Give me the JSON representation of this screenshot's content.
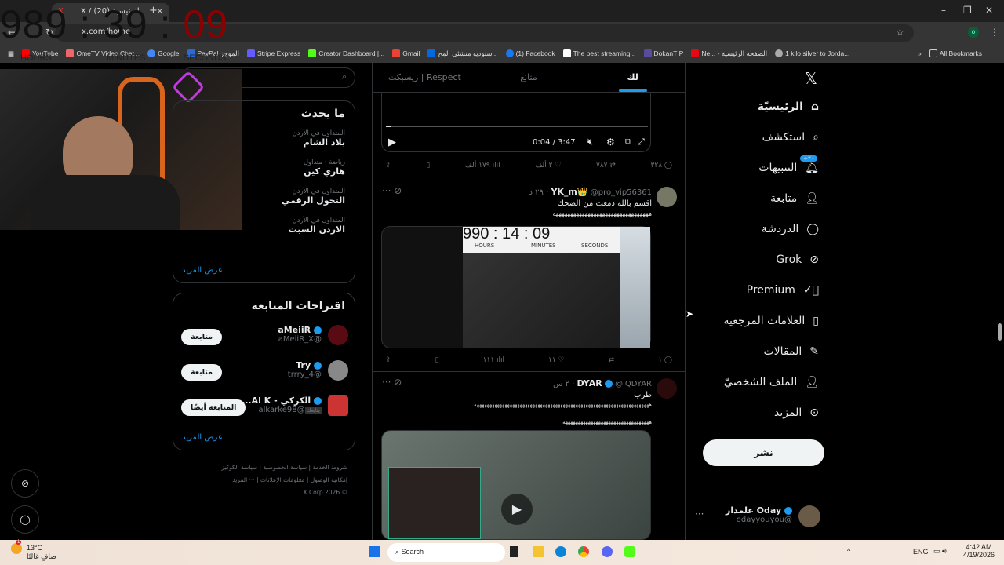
{
  "browser": {
    "tab_title": "X / الرئيسية (20)",
    "url": "x.com/home",
    "bookmarks": [
      "YouTube",
      "OmeTV Video Chat...",
      "Google",
      "PayPal الموجز",
      "Stripe Express",
      "Creator Dashboard |...",
      "Gmail",
      "ستوديو منشئي المح...",
      "(1) Facebook",
      "The best streaming...",
      "DokanTIP",
      "Ne... - الصفحة الرئيسية",
      "1 kilo silver to Jorda..."
    ],
    "all_bookmarks": "All Bookmarks",
    "profile_initial": "o"
  },
  "overlay": {
    "hours": "989",
    "minutes": "39",
    "seconds": "09",
    "hours_label": "HOURS",
    "minutes_label": "MINUTES",
    "seconds_label": "SECONDS"
  },
  "feed": {
    "tabs": [
      "لك",
      "متابَع",
      "ريسبكت | Respect"
    ],
    "video": {
      "time": "0:04 / 3:47",
      "progress": 0.018
    },
    "tweet0_actions": {
      "replies": "٣٢٨",
      "reposts": "٧٨٧",
      "likes": "٢ ألف",
      "views": "١٧٩ ألف"
    },
    "tweets": [
      {
        "name": "YK_m👑",
        "handle": "@pro_vip56361",
        "time": "٢٩ د",
        "text1": "اقسم بالله دمعت من الضحك",
        "text2": "هههههههههههههههههههههههههههههههههه",
        "replies": "١",
        "reposts": "",
        "likes": "١١",
        "views": "١١١",
        "media_timer": "990 : 14 : 09",
        "media_labels": [
          "HOURS",
          "MINUTES",
          "SECONDS"
        ]
      },
      {
        "name": "DYAR",
        "handle": "@iQDYAR",
        "time": "٢ س",
        "text1": "طرب",
        "text2": "هههههههههههههههههههههههههههههههههههههههههههههههههههههههههههههههههههههه",
        "text3": "ههههههههههههههههههههههههههههههههههه"
      }
    ]
  },
  "sidebar": {
    "search_placeholder": "بحث",
    "trending_title": "ما يحدث",
    "trends": [
      {
        "cat": "المتداول في الأردن",
        "t": "بلاد الشام"
      },
      {
        "cat": "رياضة · متداول",
        "t": "هاري كين"
      },
      {
        "cat": "المتداول في الأردن",
        "t": "التحول الرقمي"
      },
      {
        "cat": "المتداول في الأردن",
        "t": "الاردن السبت"
      }
    ],
    "show_more": "عرض المزيد",
    "who_title": "اقتراحات المتابعة",
    "who": [
      {
        "name": "aMeiiR",
        "handle": "@aMeiiR_X",
        "btn": "متابعة"
      },
      {
        "name": "Try",
        "handle": "@4_trrry",
        "btn": "متابعة"
      },
      {
        "name": "الكركي - Al K...",
        "handle": "@alkarke98",
        "tag": "يتابعك",
        "btn": "المتابعة أيضًا"
      }
    ],
    "footer": [
      "شروط الخدمة",
      "سياسة الخصوصية",
      "سياسة الكوكيز",
      "إمكانية الوصول",
      "معلومات الإعلانات",
      "··· المزيد",
      "© 2026 X Corp."
    ]
  },
  "nav": {
    "items": [
      "الرئيسيّة",
      "استكشف",
      "التنبيهات",
      "متابعة",
      "الدردشة",
      "Grok",
      "Premium",
      "العلامات المرجعية",
      "المقالات",
      "الملف الشخصيّ",
      "المزيد"
    ],
    "notif_badge": "٢٠+",
    "post": "نشر",
    "account_name": "Oday علمدار",
    "account_handle": "@odayyouyou"
  },
  "taskbar": {
    "temp": "13°C",
    "weather": "صافٍ غالبًا",
    "search": "Search",
    "lang": "ENG",
    "time": "4:42 AM",
    "date": "4/19/2026",
    "weather_badge": "1"
  },
  "colors": {
    "accent": "#1d9bf0",
    "bg": "#000000"
  }
}
